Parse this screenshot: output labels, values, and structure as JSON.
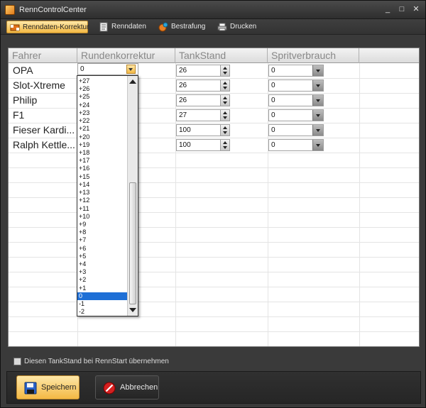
{
  "window": {
    "title": "RennControlCenter"
  },
  "window_buttons": {
    "minimize": "_",
    "maximize": "□",
    "close": "✕"
  },
  "toolbar": {
    "items": [
      {
        "label": "Renndaten-Korrektur",
        "icon": "flag-icon",
        "active": true
      },
      {
        "label": "Renndaten",
        "icon": "document-icon",
        "active": false
      },
      {
        "label": "Bestrafung",
        "icon": "penalty-icon",
        "active": false
      },
      {
        "label": "Drucken",
        "icon": "printer-icon",
        "active": false
      }
    ]
  },
  "grid": {
    "columns": [
      "Fahrer",
      "Rundenkorrektur",
      "TankStand",
      "Spritverbrauch",
      ""
    ],
    "rows": [
      {
        "fahrer": "OPA",
        "rundenkorrektur": "0",
        "tankstand": "26",
        "spritverbrauch": "0"
      },
      {
        "fahrer": "Slot-Xtreme",
        "rundenkorrektur": "",
        "tankstand": "26",
        "spritverbrauch": "0"
      },
      {
        "fahrer": "Philip",
        "rundenkorrektur": "",
        "tankstand": "26",
        "spritverbrauch": "0"
      },
      {
        "fahrer": "F1",
        "rundenkorrektur": "",
        "tankstand": "27",
        "spritverbrauch": "0"
      },
      {
        "fahrer": "Fieser Kardi...",
        "rundenkorrektur": "",
        "tankstand": "100",
        "spritverbrauch": "0"
      },
      {
        "fahrer": "Ralph Kettle...",
        "rundenkorrektur": "",
        "tankstand": "100",
        "spritverbrauch": "0"
      }
    ]
  },
  "rundenkorrektur_dropdown": {
    "options": [
      "+27",
      "+26",
      "+25",
      "+24",
      "+23",
      "+22",
      "+21",
      "+20",
      "+19",
      "+18",
      "+17",
      "+16",
      "+15",
      "+14",
      "+13",
      "+12",
      "+11",
      "+10",
      "+9",
      "+8",
      "+7",
      "+6",
      "+5",
      "+4",
      "+3",
      "+2",
      "+1",
      "0",
      "-1",
      "-2"
    ],
    "selected": "0"
  },
  "checkbox": {
    "label": "Diesen TankStand bei RennStart übernehmen",
    "checked": false
  },
  "buttons": {
    "save": "Speichern",
    "cancel": "Abbrechen"
  },
  "colors": {
    "accent": "#f4b944",
    "selection": "#1e6fd6",
    "window_bg": "#3a3a3a"
  }
}
